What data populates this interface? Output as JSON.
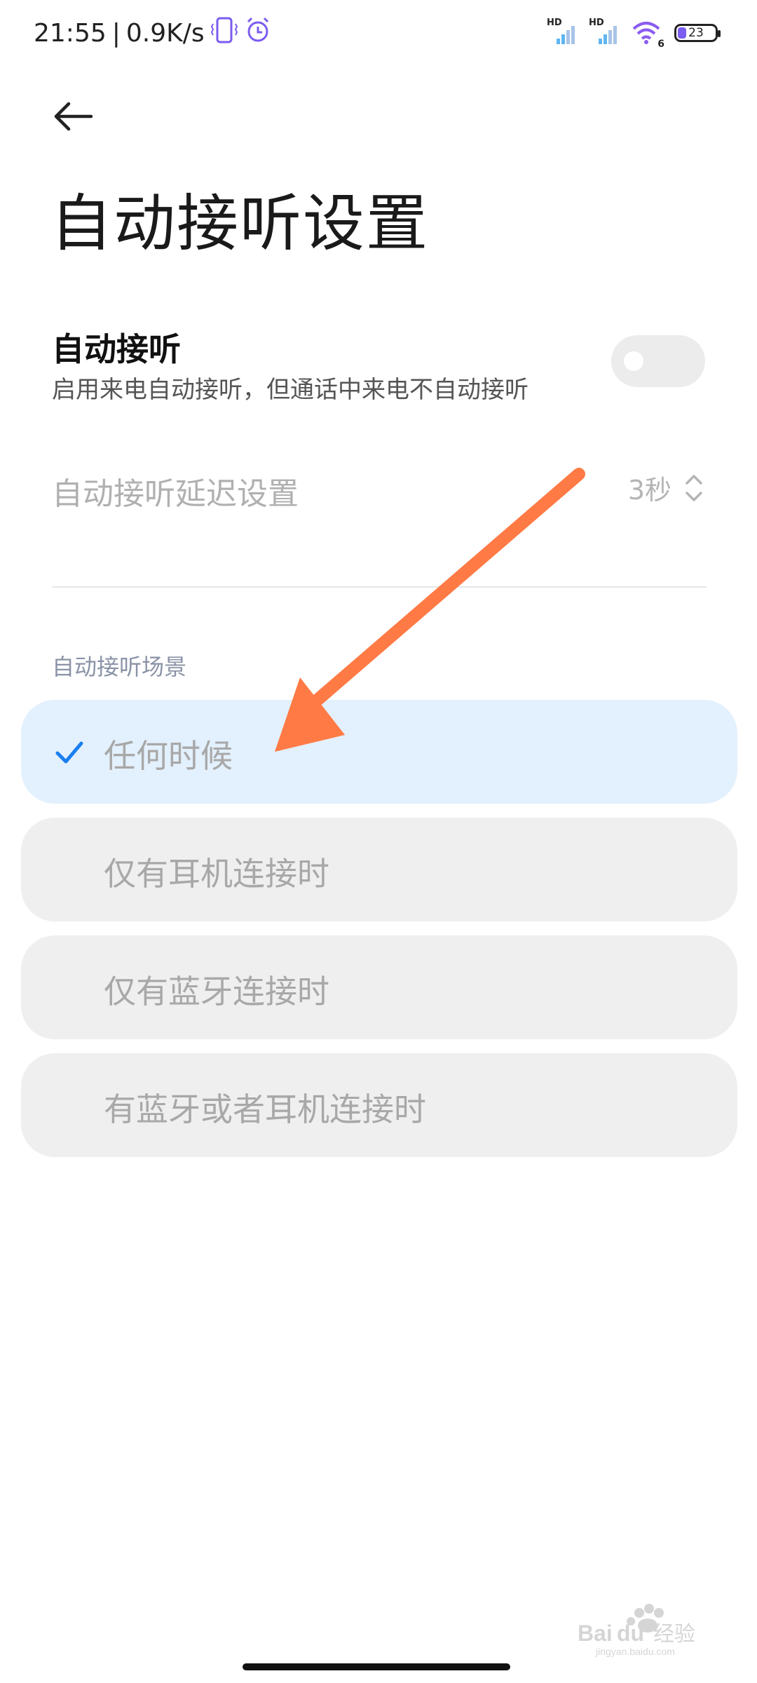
{
  "status_bar": {
    "time": "21:55",
    "separator": "|",
    "network_speed": "0.9K/s",
    "battery_level": "23",
    "signal_label_1": "HD",
    "signal_label_2": "HD",
    "wifi_label": "6",
    "icons": [
      "phone-vibrate-icon",
      "alarm-icon",
      "signal-icon",
      "signal-icon",
      "wifi-icon",
      "battery-icon"
    ]
  },
  "header": {
    "back_icon": "back-arrow-icon",
    "title": "自动接听设置"
  },
  "auto_answer": {
    "title": "自动接听",
    "description": "启用来电自动接听，但通话中来电不自动接听",
    "enabled": false
  },
  "delay": {
    "label": "自动接听延迟设置",
    "value": "3秒",
    "icon": "updown-chevron-icon"
  },
  "scenes": {
    "section_label": "自动接听场景",
    "options": [
      {
        "label": "任何时候",
        "selected": true
      },
      {
        "label": "仅有耳机连接时",
        "selected": false
      },
      {
        "label": "仅有蓝牙连接时",
        "selected": false
      },
      {
        "label": "有蓝牙或者耳机连接时",
        "selected": false
      }
    ]
  },
  "annotation": {
    "arrow_color": "#ff7a45"
  },
  "watermark": {
    "text": "Baidu经验",
    "subtext": "jingyan.baidu.com"
  },
  "colors": {
    "accent": "#1a7ff0",
    "selected_bg": "#e3f0fd",
    "option_bg": "#efefef"
  }
}
